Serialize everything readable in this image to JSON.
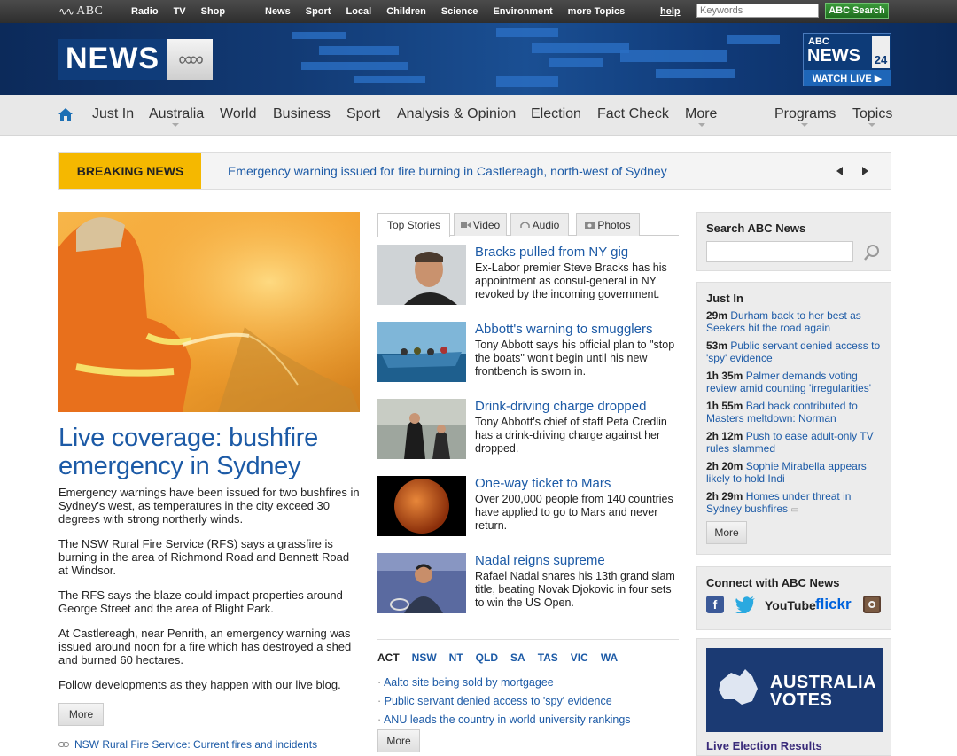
{
  "topbar": {
    "abc_logo": "ABC",
    "links_left": [
      "Radio",
      "TV",
      "Shop"
    ],
    "links_right": [
      "News",
      "Sport",
      "Local",
      "Children",
      "Science",
      "Environment",
      "more Topics"
    ],
    "help": "help",
    "search_placeholder": "Keywords",
    "search_button": "ABC Search"
  },
  "banner": {
    "news_logo": "NEWS",
    "news24": {
      "abc": "ABC",
      "news": "NEWS",
      "num": "24",
      "watch": "WATCH LIVE ▶"
    }
  },
  "nav": {
    "items": [
      "Just In",
      "Australia",
      "World",
      "Business",
      "Sport",
      "Analysis & Opinion",
      "Election",
      "Fact Check",
      "More",
      "Programs",
      "Topics"
    ]
  },
  "breaking": {
    "label": "BREAKING NEWS",
    "text": "Emergency warning issued for fire burning in Castlereagh, north-west of Sydney"
  },
  "lead": {
    "title": "Live coverage: bushfire emergency in Sydney",
    "paragraphs": [
      "Emergency warnings have been issued for two bushfires in Sydney's west, as temperatures in the city exceed 30 degrees with strong northerly winds.",
      "The NSW Rural Fire Service (RFS) says a grassfire is burning in the area of Richmond Road and Bennett Road at Windsor.",
      "The RFS says the blaze could impact properties around George Street and the area of Blight Park.",
      "At Castlereagh, near Penrith, an emergency warning was issued around noon for a fire which has destroyed a shed and burned 60 hectares.",
      "Follow developments as they happen with our live blog."
    ],
    "more": "More",
    "link": "NSW Rural Fire Service: Current fires and incidents"
  },
  "tabs": [
    "Top Stories",
    "Video",
    "Audio",
    "Photos"
  ],
  "stories": [
    {
      "title": "Bracks pulled from NY gig",
      "desc": "Ex-Labor premier Steve Bracks has his appointment as consul-general in NY revoked by the incoming government."
    },
    {
      "title": "Abbott's warning to smugglers",
      "desc": "Tony Abbott says his official plan to \"stop the boats\" won't begin until his new frontbench is sworn in."
    },
    {
      "title": "Drink-driving charge dropped",
      "desc": "Tony Abbott's chief of staff Peta Credlin has a drink-driving charge against her dropped."
    },
    {
      "title": "One-way ticket to Mars",
      "desc": "Over 200,000 people from 140 countries have applied to go to Mars and never return."
    },
    {
      "title": "Nadal reigns supreme",
      "desc": "Rafael Nadal snares his 13th grand slam title, beating Novak Djokovic in four sets to win the US Open."
    }
  ],
  "states": [
    "ACT",
    "NSW",
    "NT",
    "QLD",
    "SA",
    "TAS",
    "VIC",
    "WA"
  ],
  "local_stories": [
    "Aalto site being sold by mortgagee",
    "Public servant denied access to 'spy' evidence",
    "ANU leads the country in world university rankings"
  ],
  "local_more": "More",
  "sidebar": {
    "search_title": "Search ABC News",
    "just_in_title": "Just In",
    "just_in": [
      {
        "time": "29m",
        "text": "Durham back to her best as Seekers hit the road again"
      },
      {
        "time": "53m",
        "text": "Public servant denied access to 'spy' evidence"
      },
      {
        "time": "1h 35m",
        "text": "Palmer demands voting review amid counting 'irregularities'"
      },
      {
        "time": "1h 55m",
        "text": "Bad back contributed to Masters meltdown: Norman"
      },
      {
        "time": "2h 12m",
        "text": "Push to ease adult-only TV rules slammed"
      },
      {
        "time": "2h 20m",
        "text": "Sophie Mirabella appears likely to hold Indi"
      },
      {
        "time": "2h 29m",
        "text": "Homes under threat in Sydney bushfires"
      }
    ],
    "just_in_more": "More",
    "connect_title": "Connect with ABC News",
    "social": [
      "facebook-icon",
      "twitter-icon",
      "youtube-icon",
      "flickr-icon",
      "instagram-icon"
    ],
    "social_labels": {
      "youtube": "YouTube",
      "flickr": "flickr"
    },
    "votes": {
      "line1": "AUSTRALIA",
      "line2": "VOTES",
      "link": "Live Election Results"
    }
  },
  "colors": {
    "link_blue": "#1c5aa6",
    "breaking_yellow": "#f5b800",
    "banner_blue": "#123a74"
  }
}
